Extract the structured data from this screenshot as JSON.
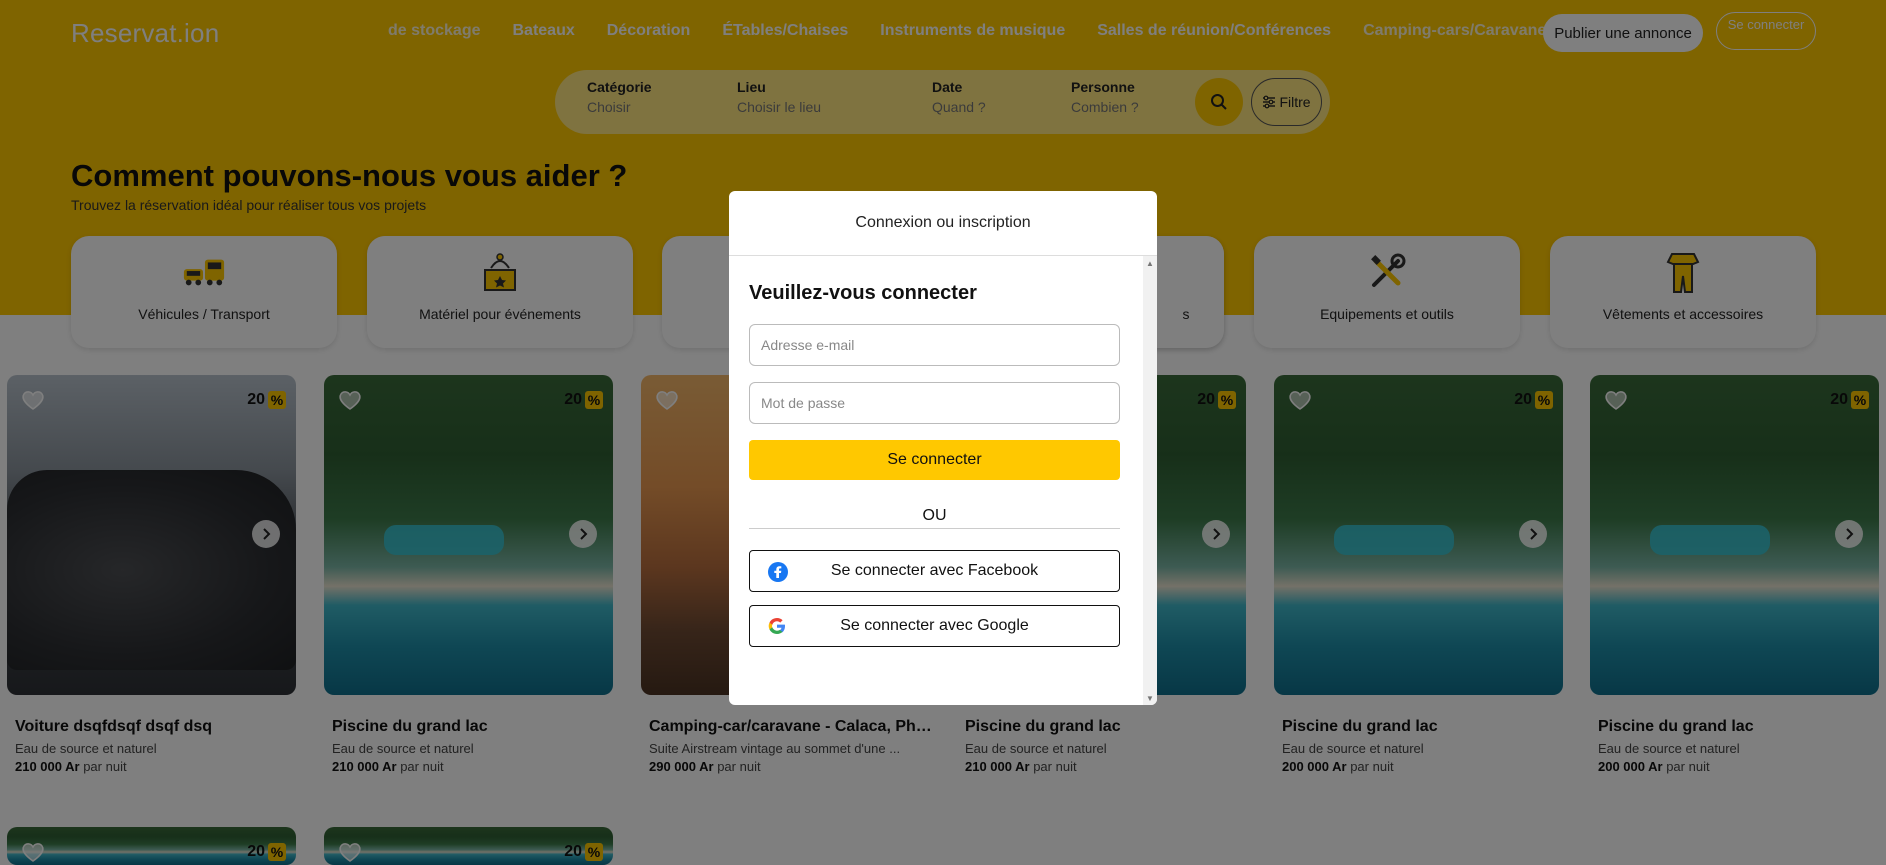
{
  "header": {
    "logo": "Reservat.ion",
    "nav": [
      "de stockage",
      "Bateaux",
      "Décoration",
      "ÉTables/Chaises",
      "Instruments de musique",
      "Salles de réunion/Conférences",
      "Camping-cars/Caravanes"
    ],
    "publish_label": "Publier une annonce",
    "login_label": "Se connecter"
  },
  "search": {
    "fields": [
      {
        "label": "Catégorie",
        "placeholder": "Choisir"
      },
      {
        "label": "Lieu",
        "placeholder": "Choisir le lieu"
      },
      {
        "label": "Date",
        "placeholder": "Quand ?"
      },
      {
        "label": "Personne",
        "placeholder": "Combien ?"
      }
    ],
    "filter_label": "Filtre"
  },
  "hero": {
    "title": "Comment pouvons-nous vous aider ?",
    "subtitle": "Trouvez la réservation idéal pour réaliser tous vos projets"
  },
  "categories": [
    {
      "label": "Véhicules / Transport",
      "icon": "vehicles-icon"
    },
    {
      "label": "Matériel pour événements",
      "icon": "event-gear-icon"
    },
    {
      "label": "",
      "icon": "hidden-category"
    },
    {
      "label": "",
      "icon": "hidden-category"
    },
    {
      "label": "s",
      "icon": "hidden-category"
    },
    {
      "label": "Equipements et outils",
      "icon": "tools-icon"
    },
    {
      "label": "Vêtements et accessoires",
      "icon": "clothes-icon"
    }
  ],
  "listings": [
    {
      "title": "Voiture dsqfdsqf dsqf dsq",
      "desc": "Eau de source et naturel",
      "price": "210 000 Ar",
      "unit": "par nuit",
      "promo": "20",
      "photo": "car"
    },
    {
      "title": "Piscine du grand lac",
      "desc": "Eau de source et naturel",
      "price": "210 000 Ar",
      "unit": "par nuit",
      "promo": "20",
      "photo": "resort"
    },
    {
      "title": "Camping-car/caravane - Calaca, Phil...",
      "desc": "Suite Airstream vintage au sommet d'une ...",
      "price": "290 000 Ar",
      "unit": "par nuit",
      "promo": "",
      "photo": "desert"
    },
    {
      "title": "Piscine du grand lac",
      "desc": "Eau de source et naturel",
      "price": "210 000 Ar",
      "unit": "par nuit",
      "promo": "20",
      "photo": "resort"
    },
    {
      "title": "Piscine du grand lac",
      "desc": "Eau de source et naturel",
      "price": "200 000 Ar",
      "unit": "par nuit",
      "promo": "20",
      "photo": "resort"
    },
    {
      "title": "Piscine du grand lac",
      "desc": "Eau de source et naturel",
      "price": "200 000 Ar",
      "unit": "par nuit",
      "promo": "20",
      "photo": "resort"
    },
    {
      "title": "",
      "desc": "",
      "price": "",
      "unit": "",
      "promo": "20",
      "photo": "resort"
    },
    {
      "title": "",
      "desc": "",
      "price": "",
      "unit": "",
      "promo": "20",
      "photo": "resort"
    }
  ],
  "modal": {
    "title": "Connexion ou inscription",
    "heading": "Veuillez-vous connecter",
    "email_placeholder": "Adresse e-mail",
    "password_placeholder": "Mot de passe",
    "submit_label": "Se connecter",
    "or_label": "OU",
    "facebook_label": "Se connecter avec Facebook",
    "google_label": "Se connecter avec Google"
  },
  "colors": {
    "brand_yellow": "#ffc800",
    "facebook_blue": "#1877f2"
  }
}
